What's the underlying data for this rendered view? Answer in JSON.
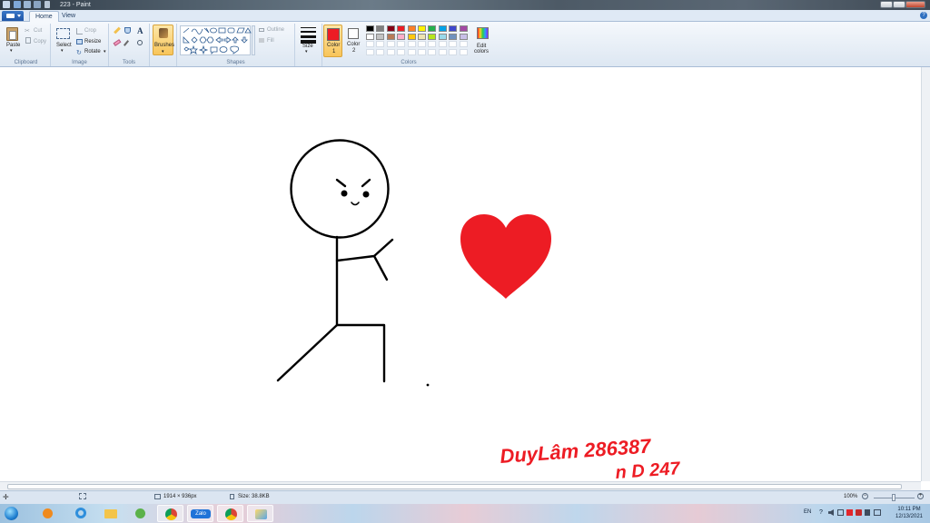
{
  "window": {
    "title": "223 - Paint"
  },
  "tabs": [
    {
      "label": "Home",
      "active": true
    },
    {
      "label": "View",
      "active": false
    }
  ],
  "clipboard": {
    "paste": "Paste",
    "cut": "Cut",
    "copy": "Copy",
    "group": "Clipboard"
  },
  "image": {
    "select": "Select",
    "crop": "Crop",
    "resize": "Resize",
    "rotate": "Rotate",
    "group": "Image"
  },
  "tools": {
    "group": "Tools"
  },
  "brushes": {
    "label": "Brushes"
  },
  "shapes": {
    "outline": "Outline",
    "fill": "Fill",
    "group": "Shapes"
  },
  "size": {
    "label": "Size"
  },
  "colors": {
    "color1": {
      "label": "Color",
      "num": "1",
      "value": "#ed1c24"
    },
    "color2": {
      "label": "Color",
      "num": "2",
      "value": "#ffffff"
    },
    "edit": {
      "line1": "Edit",
      "line2": "colors"
    },
    "group": "Colors",
    "palette_row1": [
      "#000000",
      "#7f7f7f",
      "#880015",
      "#ed1c24",
      "#ff7f27",
      "#fff200",
      "#22b14c",
      "#00a2e8",
      "#3f48cc",
      "#a349a4"
    ],
    "palette_row2": [
      "#ffffff",
      "#c3c3c3",
      "#b97a57",
      "#ffaec9",
      "#ffc90e",
      "#efe4b0",
      "#b5e61d",
      "#99d9ea",
      "#7092be",
      "#c8bfe7"
    ]
  },
  "canvas": {
    "line1": "DuyLâm 286387",
    "line2": "n D 247",
    "text_color": "#ed1c24",
    "heart_color": "#ed1c24"
  },
  "status": {
    "dimensions": "1914 × 936px",
    "size": "Size: 38.8KB",
    "zoom": "100%"
  },
  "taskbar": {
    "apps": [
      "windows-explorer",
      "media-player",
      "internet-explorer",
      "folder",
      "camtasia",
      "chrome",
      "zalo",
      "chrome-alt",
      "paint"
    ],
    "zalo_label": "Zalo",
    "lang": "EN",
    "time": "10:11 PM",
    "date": "12/13/2021"
  }
}
